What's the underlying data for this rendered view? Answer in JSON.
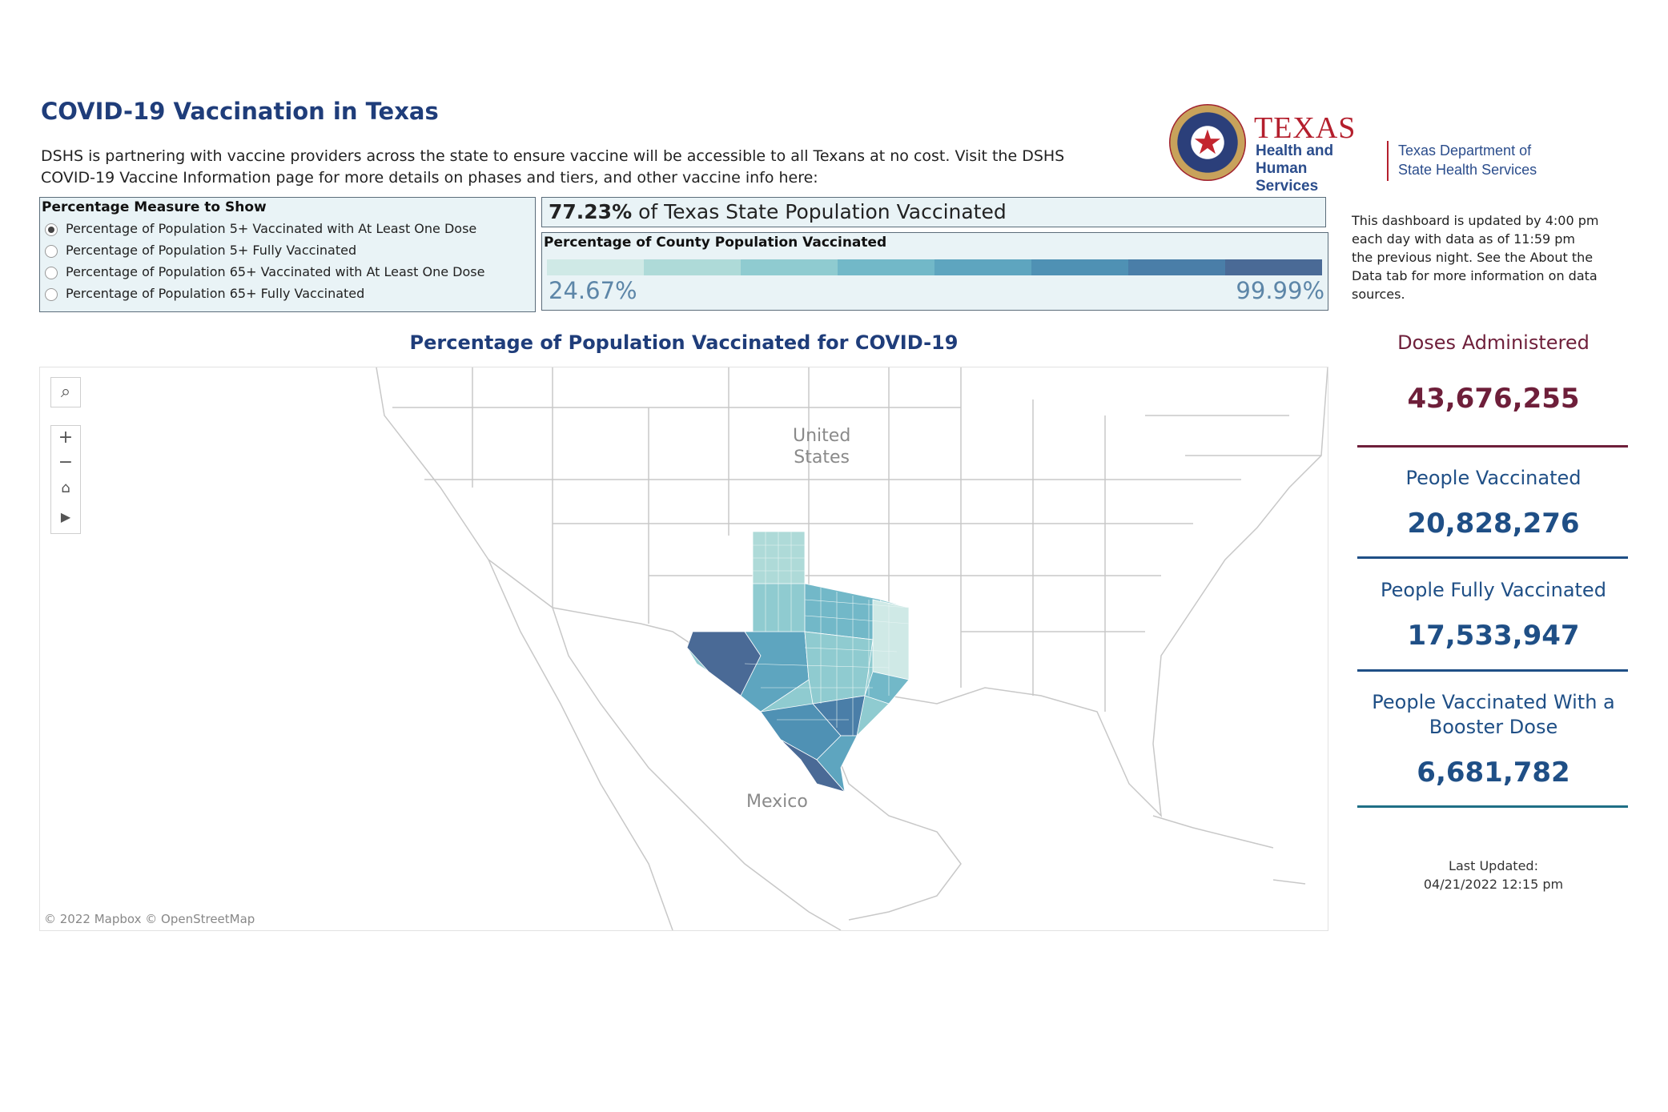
{
  "title": "COVID-19 Vaccination in Texas",
  "intro": "DSHS is partnering with vaccine providers across the state to ensure vaccine will be accessible to all Texans at no cost. Visit the DSHS COVID-19 Vaccine Information page for more details on phases and tiers, and other vaccine info here:",
  "logo": {
    "texas": "TEXAS",
    "hhs_line1": "Health and Human",
    "hhs_line2": "Services",
    "dshs_line1": "Texas Department of",
    "dshs_line2": "State Health Services"
  },
  "measure": {
    "title": "Percentage Measure to Show",
    "options": [
      {
        "label": "Percentage of Population 5+ Vaccinated with At Least One Dose",
        "selected": true
      },
      {
        "label": "Percentage of Population 5+ Fully Vaccinated",
        "selected": false
      },
      {
        "label": "Percentage of Population 65+ Vaccinated with At Least One Dose",
        "selected": false
      },
      {
        "label": "Percentage of Population 65+ Fully Vaccinated",
        "selected": false
      }
    ]
  },
  "state": {
    "pct": "77.23%",
    "suffix": " of Texas State Population Vaccinated"
  },
  "legend": {
    "title": "Percentage of County Population Vaccinated",
    "min": "24.67%",
    "max": "99.99%",
    "colors": [
      "#cfe9e6",
      "#aedad8",
      "#8fcbd0",
      "#72b8c8",
      "#5ea5bf",
      "#4f91b4",
      "#4a7ea8",
      "#4a6a96"
    ]
  },
  "update_note": "This dashboard is updated by 4:00 pm each day with data as of 11:59 pm the previous night. See the About the Data tab for more information on data sources.",
  "map": {
    "title": "Percentage of Population Vaccinated for COVID-19",
    "label_us_1": "United",
    "label_us_2": "States",
    "label_mx": "Mexico",
    "credit": "© 2022 Mapbox © OpenStreetMap",
    "controls": [
      "search-icon",
      "zoom-in-icon",
      "zoom-out-icon",
      "home-icon",
      "play-icon"
    ]
  },
  "stats": [
    {
      "label": "Doses Administered",
      "value": "43,676,255",
      "color": "#6e1f3a"
    },
    {
      "label": "People Vaccinated",
      "value": "20,828,276",
      "color": "#1f4f86"
    },
    {
      "label": "People Fully Vaccinated",
      "value": "17,533,947",
      "color": "#1f4f86"
    },
    {
      "label": "People Vaccinated With a Booster Dose",
      "value": "6,681,782",
      "color": "#1f4f86"
    }
  ],
  "last_updated_label": "Last Updated:",
  "last_updated_value": "04/21/2022 12:15 pm"
}
